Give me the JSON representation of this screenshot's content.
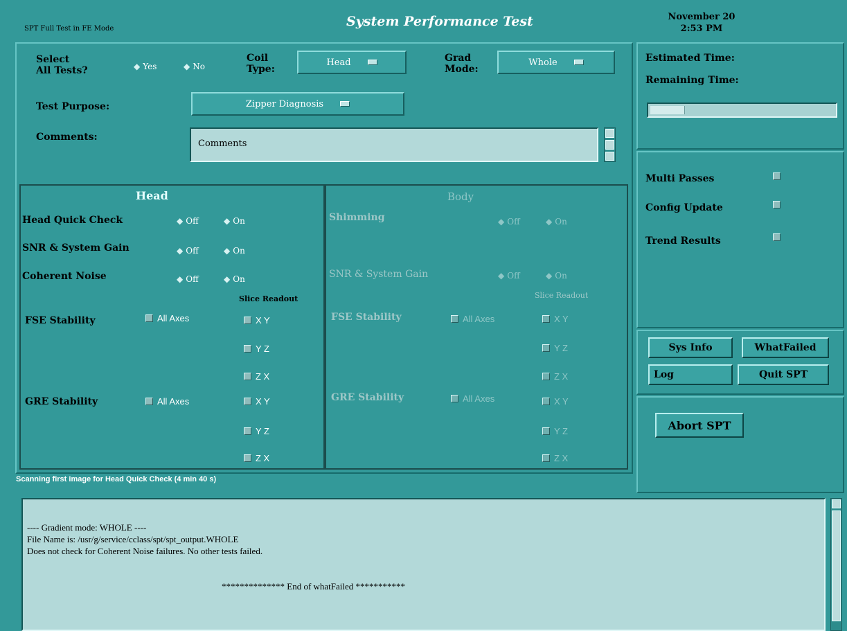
{
  "header": {
    "mode_text": "SPT Full Test in FE Mode",
    "title": "System Performance Test",
    "date": "November 20",
    "time": "2:53 PM"
  },
  "controls": {
    "select_all_label_1": "Select",
    "select_all_label_2": "All Tests?",
    "select_yes": "Yes",
    "select_no": "No",
    "coil_label_1": "Coil",
    "coil_label_2": "Type:",
    "coil_value": "Head",
    "grad_label_1": "Grad",
    "grad_label_2": "Mode:",
    "grad_value": "Whole",
    "purpose_label": "Test Purpose:",
    "purpose_value": "Zipper Diagnosis",
    "comments_label": "Comments:",
    "comments_value": "Comments"
  },
  "head": {
    "title": "Head",
    "quick_check": "Head Quick Check",
    "snr": "SNR & System Gain",
    "coherent": "Coherent Noise",
    "off": "Off",
    "on": "On",
    "slice_readout": "Slice Readout",
    "fse": "FSE Stability",
    "gre": "GRE Stability",
    "all_axes": "All Axes",
    "xy": "X  Y",
    "yz": "Y  Z",
    "zx": "Z  X"
  },
  "body": {
    "title": "Body",
    "shimming": "Shimming",
    "snr": "SNR & System Gain",
    "off": "Off",
    "on": "On",
    "slice_readout": "Slice Readout",
    "fse": "FSE Stability",
    "gre": "GRE Stability",
    "all_axes": "All Axes",
    "xy": "X  Y",
    "yz": "Y  Z",
    "zx": "Z  X"
  },
  "right": {
    "estimated": "Estimated Time:",
    "remaining": "Remaining Time:",
    "progress": 0.18,
    "multi": "Multi Passes",
    "config": "Config Update",
    "trend": "Trend Results",
    "sysinfo": "Sys Info",
    "whatfailed": "WhatFailed",
    "log": "Log",
    "quit": "Quit SPT",
    "abort": "Abort SPT"
  },
  "status": "Scanning first image for Head Quick Check (4 min 40 s)",
  "log_lines": {
    "l1": "---- Gradient mode: WHOLE ----",
    "l2": "File Name is: /usr/g/service/cclass/spt/spt_output.WHOLE",
    "l3": "Does not check for Coherent Noise failures. No other tests failed.",
    "l4": "************** End  of whatFailed ***********"
  },
  "colors": {
    "background": "#339999",
    "text_area": "#b3d9d9",
    "disabled_text": "#9dc7c7"
  }
}
